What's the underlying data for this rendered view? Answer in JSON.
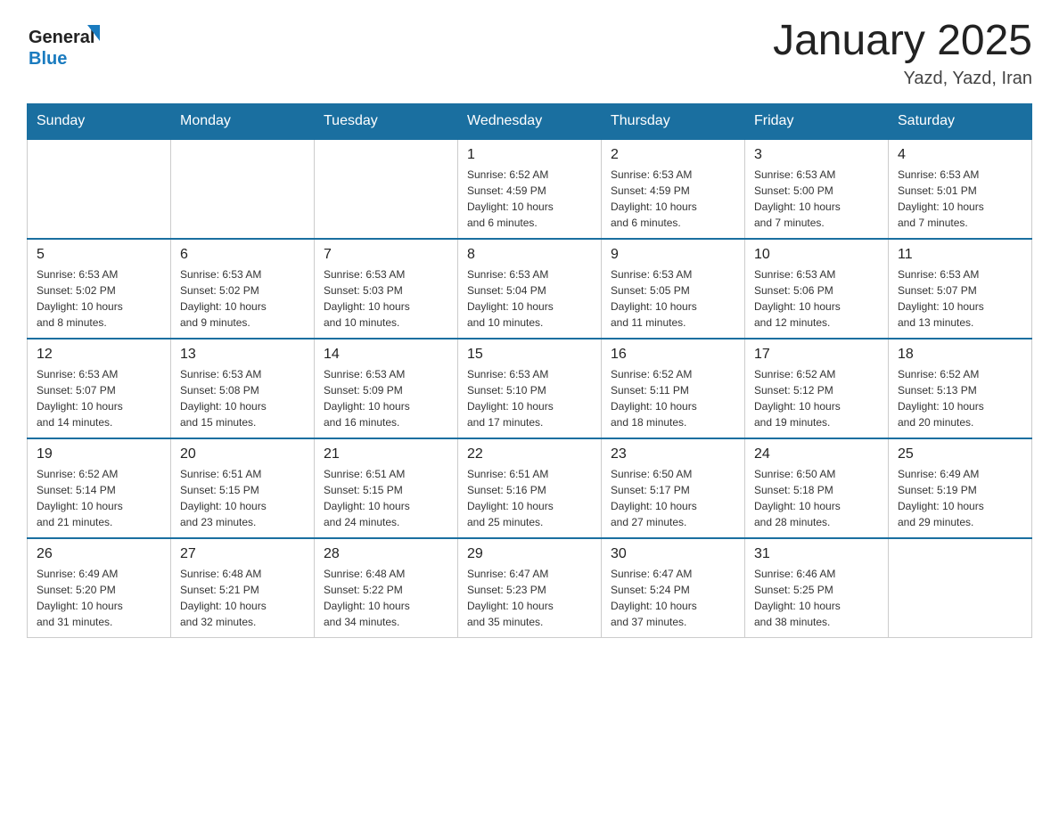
{
  "logo": {
    "text_general": "General",
    "text_blue": "Blue"
  },
  "title": "January 2025",
  "subtitle": "Yazd, Yazd, Iran",
  "headers": [
    "Sunday",
    "Monday",
    "Tuesday",
    "Wednesday",
    "Thursday",
    "Friday",
    "Saturday"
  ],
  "weeks": [
    [
      {
        "day": "",
        "info": ""
      },
      {
        "day": "",
        "info": ""
      },
      {
        "day": "",
        "info": ""
      },
      {
        "day": "1",
        "info": "Sunrise: 6:52 AM\nSunset: 4:59 PM\nDaylight: 10 hours\nand 6 minutes."
      },
      {
        "day": "2",
        "info": "Sunrise: 6:53 AM\nSunset: 4:59 PM\nDaylight: 10 hours\nand 6 minutes."
      },
      {
        "day": "3",
        "info": "Sunrise: 6:53 AM\nSunset: 5:00 PM\nDaylight: 10 hours\nand 7 minutes."
      },
      {
        "day": "4",
        "info": "Sunrise: 6:53 AM\nSunset: 5:01 PM\nDaylight: 10 hours\nand 7 minutes."
      }
    ],
    [
      {
        "day": "5",
        "info": "Sunrise: 6:53 AM\nSunset: 5:02 PM\nDaylight: 10 hours\nand 8 minutes."
      },
      {
        "day": "6",
        "info": "Sunrise: 6:53 AM\nSunset: 5:02 PM\nDaylight: 10 hours\nand 9 minutes."
      },
      {
        "day": "7",
        "info": "Sunrise: 6:53 AM\nSunset: 5:03 PM\nDaylight: 10 hours\nand 10 minutes."
      },
      {
        "day": "8",
        "info": "Sunrise: 6:53 AM\nSunset: 5:04 PM\nDaylight: 10 hours\nand 10 minutes."
      },
      {
        "day": "9",
        "info": "Sunrise: 6:53 AM\nSunset: 5:05 PM\nDaylight: 10 hours\nand 11 minutes."
      },
      {
        "day": "10",
        "info": "Sunrise: 6:53 AM\nSunset: 5:06 PM\nDaylight: 10 hours\nand 12 minutes."
      },
      {
        "day": "11",
        "info": "Sunrise: 6:53 AM\nSunset: 5:07 PM\nDaylight: 10 hours\nand 13 minutes."
      }
    ],
    [
      {
        "day": "12",
        "info": "Sunrise: 6:53 AM\nSunset: 5:07 PM\nDaylight: 10 hours\nand 14 minutes."
      },
      {
        "day": "13",
        "info": "Sunrise: 6:53 AM\nSunset: 5:08 PM\nDaylight: 10 hours\nand 15 minutes."
      },
      {
        "day": "14",
        "info": "Sunrise: 6:53 AM\nSunset: 5:09 PM\nDaylight: 10 hours\nand 16 minutes."
      },
      {
        "day": "15",
        "info": "Sunrise: 6:53 AM\nSunset: 5:10 PM\nDaylight: 10 hours\nand 17 minutes."
      },
      {
        "day": "16",
        "info": "Sunrise: 6:52 AM\nSunset: 5:11 PM\nDaylight: 10 hours\nand 18 minutes."
      },
      {
        "day": "17",
        "info": "Sunrise: 6:52 AM\nSunset: 5:12 PM\nDaylight: 10 hours\nand 19 minutes."
      },
      {
        "day": "18",
        "info": "Sunrise: 6:52 AM\nSunset: 5:13 PM\nDaylight: 10 hours\nand 20 minutes."
      }
    ],
    [
      {
        "day": "19",
        "info": "Sunrise: 6:52 AM\nSunset: 5:14 PM\nDaylight: 10 hours\nand 21 minutes."
      },
      {
        "day": "20",
        "info": "Sunrise: 6:51 AM\nSunset: 5:15 PM\nDaylight: 10 hours\nand 23 minutes."
      },
      {
        "day": "21",
        "info": "Sunrise: 6:51 AM\nSunset: 5:15 PM\nDaylight: 10 hours\nand 24 minutes."
      },
      {
        "day": "22",
        "info": "Sunrise: 6:51 AM\nSunset: 5:16 PM\nDaylight: 10 hours\nand 25 minutes."
      },
      {
        "day": "23",
        "info": "Sunrise: 6:50 AM\nSunset: 5:17 PM\nDaylight: 10 hours\nand 27 minutes."
      },
      {
        "day": "24",
        "info": "Sunrise: 6:50 AM\nSunset: 5:18 PM\nDaylight: 10 hours\nand 28 minutes."
      },
      {
        "day": "25",
        "info": "Sunrise: 6:49 AM\nSunset: 5:19 PM\nDaylight: 10 hours\nand 29 minutes."
      }
    ],
    [
      {
        "day": "26",
        "info": "Sunrise: 6:49 AM\nSunset: 5:20 PM\nDaylight: 10 hours\nand 31 minutes."
      },
      {
        "day": "27",
        "info": "Sunrise: 6:48 AM\nSunset: 5:21 PM\nDaylight: 10 hours\nand 32 minutes."
      },
      {
        "day": "28",
        "info": "Sunrise: 6:48 AM\nSunset: 5:22 PM\nDaylight: 10 hours\nand 34 minutes."
      },
      {
        "day": "29",
        "info": "Sunrise: 6:47 AM\nSunset: 5:23 PM\nDaylight: 10 hours\nand 35 minutes."
      },
      {
        "day": "30",
        "info": "Sunrise: 6:47 AM\nSunset: 5:24 PM\nDaylight: 10 hours\nand 37 minutes."
      },
      {
        "day": "31",
        "info": "Sunrise: 6:46 AM\nSunset: 5:25 PM\nDaylight: 10 hours\nand 38 minutes."
      },
      {
        "day": "",
        "info": ""
      }
    ]
  ]
}
